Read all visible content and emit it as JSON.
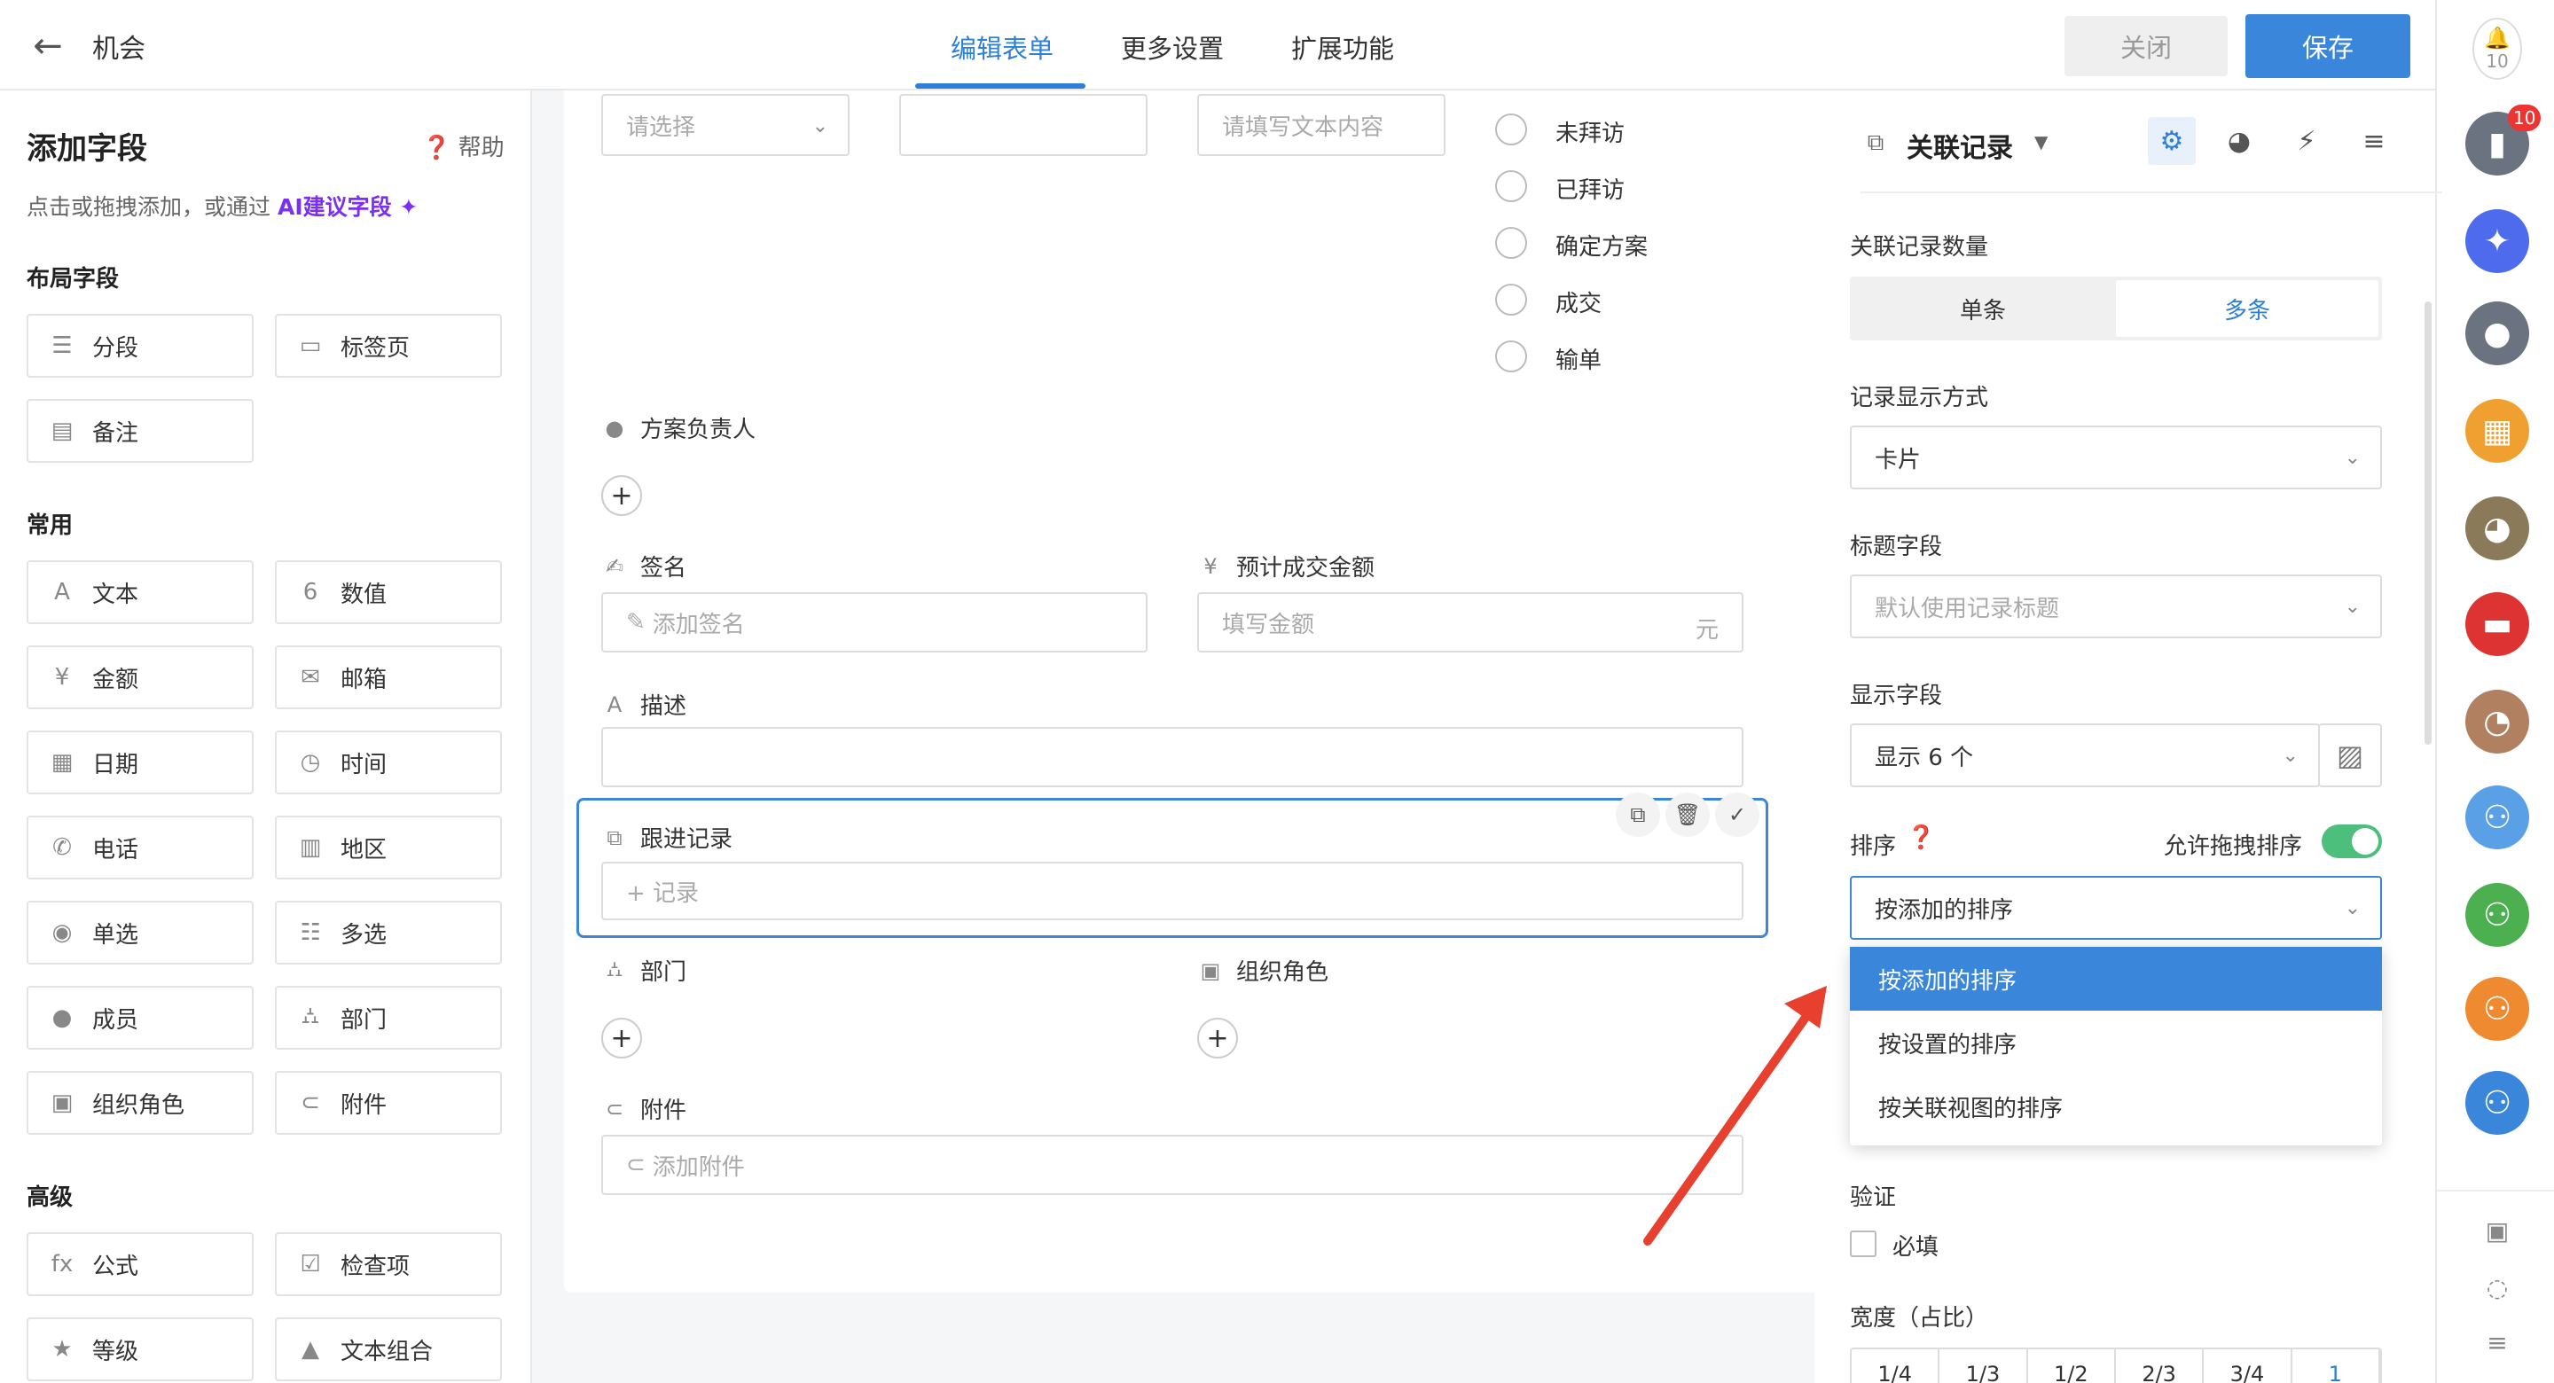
{
  "header": {
    "title": "机会",
    "tabs": [
      "编辑表单",
      "更多设置",
      "扩展功能"
    ],
    "close_label": "关闭",
    "save_label": "保存"
  },
  "rail": {
    "notify_count": "10",
    "badge_count": "10"
  },
  "left": {
    "title": "添加字段",
    "help": "帮助",
    "hint_prefix": "点击或拖拽添加，或通过",
    "hint_ai": "AI建议字段",
    "sections": {
      "layout": "布局字段",
      "common": "常用",
      "advanced": "高级"
    },
    "layout_fields": [
      "分段",
      "标签页",
      "备注"
    ],
    "common_fields": [
      "文本",
      "数值",
      "金额",
      "邮箱",
      "日期",
      "时间",
      "电话",
      "地区",
      "单选",
      "多选",
      "成员",
      "部门",
      "组织角色",
      "附件"
    ],
    "advanced_fields": [
      "公式",
      "检查项",
      "等级",
      "文本组合"
    ]
  },
  "form": {
    "select_placeholder": "请选择",
    "text_placeholder": "请填写文本内容",
    "radio_options": [
      "未拜访",
      "已拜访",
      "确定方案",
      "成交",
      "输单"
    ],
    "owner_label": "方案负责人",
    "sign_label": "签名",
    "sign_placeholder": "添加签名",
    "amount_label": "预计成交金额",
    "amount_placeholder": "填写金额",
    "amount_unit": "元",
    "desc_label": "描述",
    "follow_label": "跟进记录",
    "follow_add": "+ 记录",
    "dept_label": "部门",
    "role_label": "组织角色",
    "attach_label": "附件",
    "attach_placeholder": "添加附件"
  },
  "props": {
    "field_type": "关联记录",
    "count_title": "关联记录数量",
    "count_single": "单条",
    "count_multi": "多条",
    "display_title": "记录显示方式",
    "display_value": "卡片",
    "title_field_title": "标题字段",
    "title_field_placeholder": "默认使用记录标题",
    "show_fields_title": "显示字段",
    "show_fields_value": "显示 6 个",
    "sort_title": "排序",
    "drag_sort_label": "允许拖拽排序",
    "sort_value": "按添加的排序",
    "sort_options": [
      "按添加的排序",
      "按设置的排序",
      "按关联视图的排序"
    ],
    "validate_title": "验证",
    "required_label": "必填",
    "width_title": "宽度（占比）",
    "width_options": [
      "1/4",
      "1/3",
      "1/2",
      "2/3",
      "3/4",
      "1"
    ]
  },
  "colors": {
    "accent": "#3a86db",
    "ai": "#7b2ff2",
    "toggle_on": "#4cbf7c",
    "annotation_arrow": "#e8402f"
  }
}
